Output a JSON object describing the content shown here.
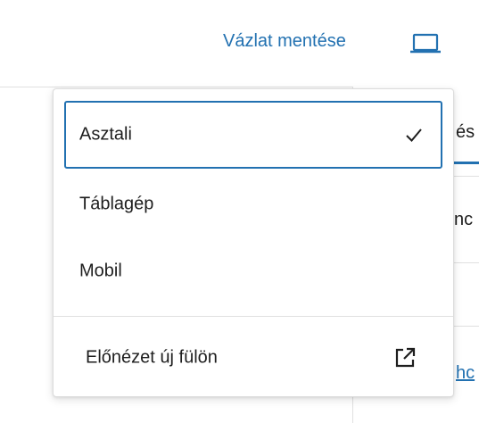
{
  "header": {
    "save_draft_label": "Vázlat mentése",
    "preview_icon": "desktop-icon"
  },
  "sidebar": {
    "tab_fragment": "és",
    "row_fragment": "nc",
    "link_fragment": "hc"
  },
  "preview_menu": {
    "items": [
      {
        "label": "Asztali",
        "selected": true,
        "icon": "check-icon"
      },
      {
        "label": "Táblagép",
        "selected": false
      },
      {
        "label": "Mobil",
        "selected": false
      }
    ],
    "external": {
      "label": "Előnézet új fülön",
      "icon": "external-link-icon"
    }
  },
  "colors": {
    "accent": "#2271b1",
    "text": "#1e1e1e",
    "border": "#e0e0e0"
  }
}
